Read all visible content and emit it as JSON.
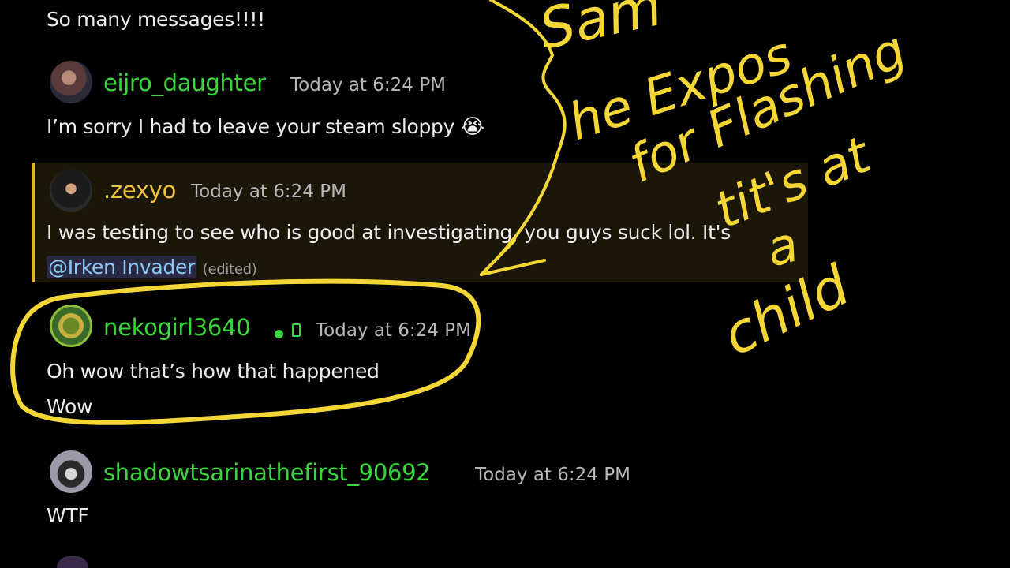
{
  "messages": {
    "prev_line": "So many messages!!!!",
    "m1": {
      "username": "eijro_daughter",
      "timestamp": "Today at 6:24 PM",
      "text": "I’m sorry I had to leave your steam sloppy",
      "emoji": "😭",
      "username_color": "#3bd63b"
    },
    "m2": {
      "username": ".zexyo",
      "timestamp": "Today at 6:24 PM",
      "text": "I was testing to see who is good at investigating, you guys suck lol. It's",
      "mention": "@Irken Invader",
      "edited": "(edited)",
      "username_color": "#f0c23a"
    },
    "m3": {
      "username": "nekogirl3640",
      "timestamp": "Today at 6:24 PM",
      "line1": "Oh wow that’s how that happened",
      "line2": "Wow",
      "username_color": "#3bd63b"
    },
    "m4": {
      "username": "shadowtsarinathefirst_90692",
      "timestamp": "Today at 6:24 PM",
      "text": "WTF",
      "username_color": "#3bd63b"
    }
  },
  "annotation": {
    "line1": "Sam",
    "line2": "he Expos",
    "line3": "for Flashing",
    "line4": "tit's at",
    "line5": "a",
    "line6": "child",
    "color": "#f4d635"
  },
  "icons": {
    "status": "online-dot-icon",
    "device": "mobile-phone-icon"
  }
}
